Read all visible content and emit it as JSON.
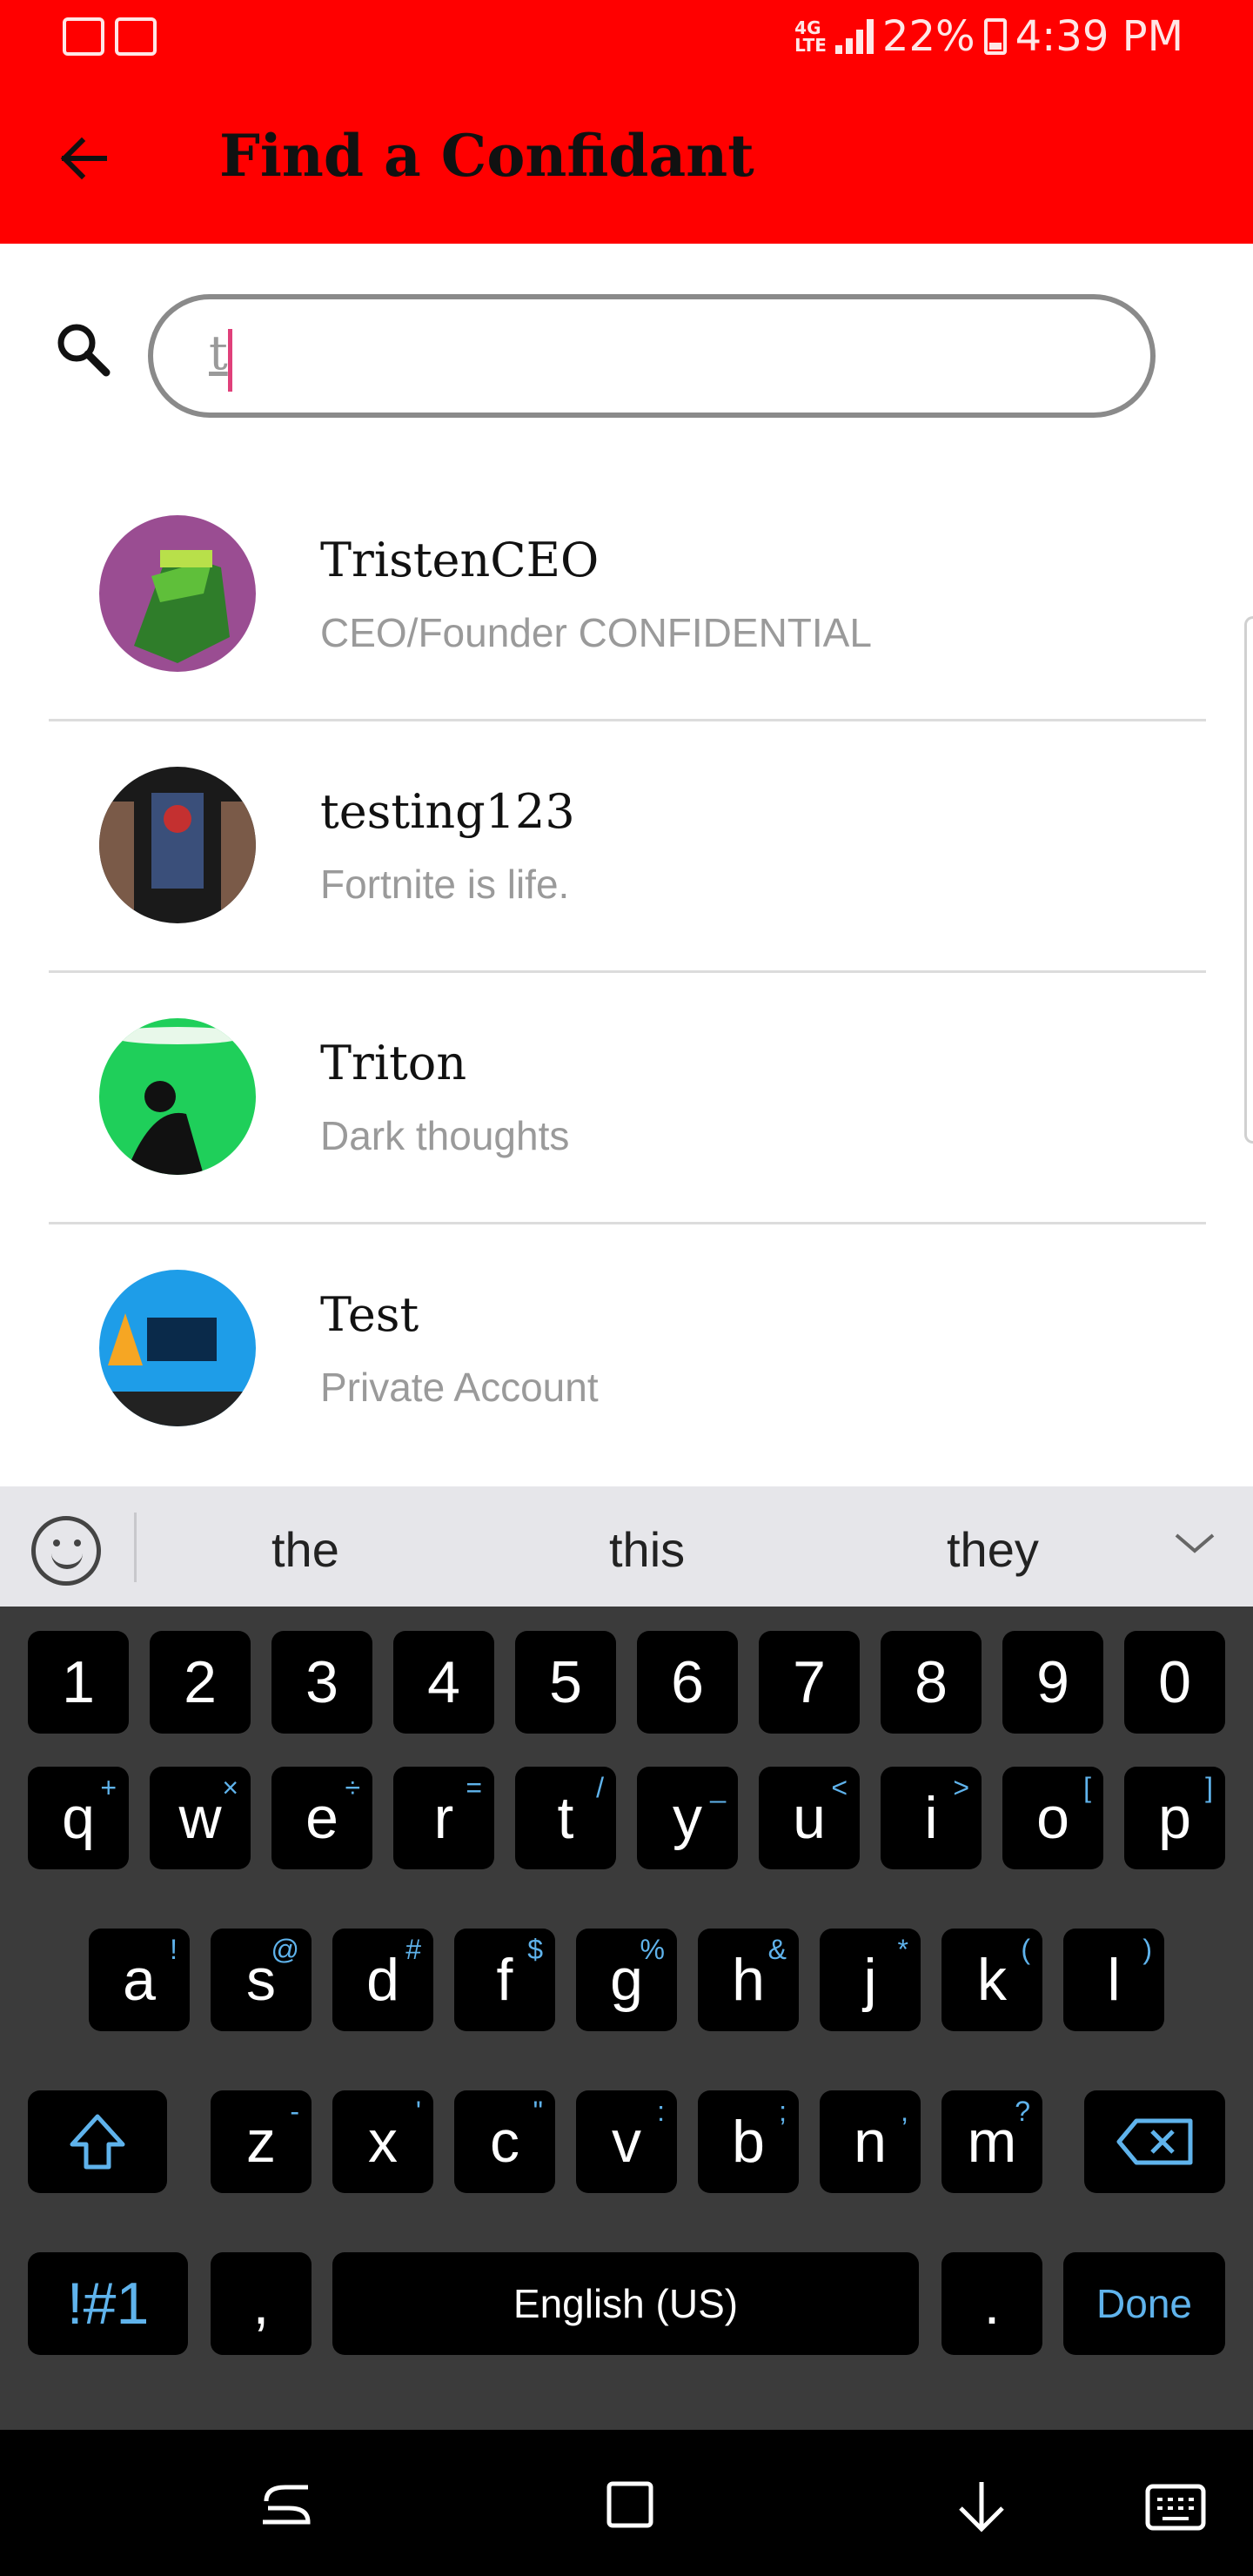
{
  "status": {
    "battery": "22%",
    "time": "4:39 PM",
    "network": "4G LTE"
  },
  "header": {
    "title": "Find a Confidant",
    "back_icon": "arrow-left-icon",
    "bg": "#ff0000"
  },
  "search": {
    "value": "t",
    "icon": "search-icon"
  },
  "results": [
    {
      "name": "TristenCEO",
      "bio": "CEO/Founder CONFIDENTIAL"
    },
    {
      "name": "testing123",
      "bio": "Fortnite is life."
    },
    {
      "name": "Triton",
      "bio": "Dark thoughts"
    },
    {
      "name": "Test",
      "bio": "Private Account"
    }
  ],
  "keyboard": {
    "suggestions": [
      "the",
      "this",
      "they"
    ],
    "numbers": [
      "1",
      "2",
      "3",
      "4",
      "5",
      "6",
      "7",
      "8",
      "9",
      "0"
    ],
    "row1": [
      [
        "q",
        "+"
      ],
      [
        "w",
        "×"
      ],
      [
        "e",
        "÷"
      ],
      [
        "r",
        "="
      ],
      [
        "t",
        "/"
      ],
      [
        "y",
        "_"
      ],
      [
        "u",
        "<"
      ],
      [
        "i",
        ">"
      ],
      [
        "o",
        "["
      ],
      [
        "p",
        "]"
      ]
    ],
    "row2": [
      [
        "a",
        "!"
      ],
      [
        "s",
        "@"
      ],
      [
        "d",
        "#"
      ],
      [
        "f",
        "$"
      ],
      [
        "g",
        "%"
      ],
      [
        "h",
        "&"
      ],
      [
        "j",
        "*"
      ],
      [
        "k",
        "("
      ],
      [
        "l",
        ")"
      ]
    ],
    "row3": [
      [
        "z",
        "-"
      ],
      [
        "x",
        "'"
      ],
      [
        "c",
        "\""
      ],
      [
        "v",
        ":"
      ],
      [
        "b",
        ";"
      ],
      [
        "n",
        ","
      ],
      [
        "m",
        "?"
      ]
    ],
    "symbols_label": "!#1",
    "comma": ",",
    "space_label": "English (US)",
    "period": ".",
    "done_label": "Done",
    "accent": "#5fb3ec"
  }
}
